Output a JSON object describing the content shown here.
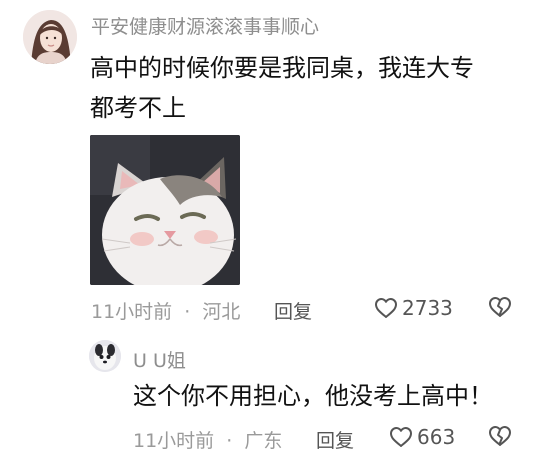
{
  "comment": {
    "username": "平安健康财源滚滚事事顺心",
    "text_line1": "高中的时候你要是我同桌，我连大专",
    "text_line2": "都考不上",
    "time": "11小时前",
    "separator": "·",
    "location": "河北",
    "reply_label": "回复",
    "like_count": "2733"
  },
  "reply": {
    "username": "U U姐",
    "text": "这个你不用担心，他没考上高中！",
    "time": "11小时前",
    "separator": "·",
    "location": "广东",
    "reply_label": "回复",
    "like_count": "663"
  },
  "icons": {
    "like": "heart-outline-icon",
    "dislike": "broken-heart-icon"
  },
  "colors": {
    "text": "#111111",
    "muted": "#9a9a9a",
    "action": "#555555"
  }
}
